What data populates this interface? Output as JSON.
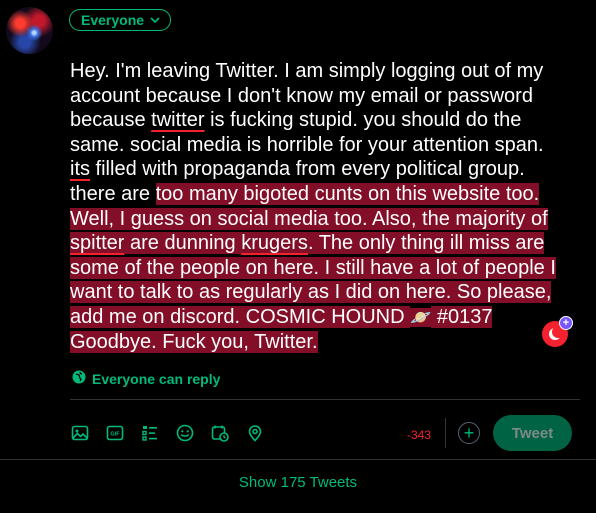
{
  "audience": {
    "label": "Everyone"
  },
  "tweet": {
    "lines": [
      [
        {
          "t": "Hey. I'm leaving Twitter. I am simply logging out of my"
        }
      ],
      [
        {
          "t": "account because I don't know my email or password"
        }
      ],
      [
        {
          "t": "because "
        },
        {
          "t": "twitter",
          "ul": true
        },
        {
          "t": " is fucking stupid. you should do the"
        }
      ],
      [
        {
          "t": "same. social media is horrible for your attention span."
        }
      ],
      [
        {
          "t": "its",
          "ul": true
        },
        {
          "t": " filled with propaganda from every political group."
        }
      ],
      [
        {
          "t": "there are "
        },
        {
          "t": "too many bigoted cunts on this website too.",
          "hl": true
        }
      ],
      [
        {
          "t": "Well, I guess on social media too. Also, the majority of",
          "hl": true
        }
      ],
      [
        {
          "t": "spitter",
          "hl": true,
          "ul": true
        },
        {
          "t": " are dunning ",
          "hl": true
        },
        {
          "t": "krugers",
          "hl": true,
          "ul": true
        },
        {
          "t": ". The only thing ill miss are",
          "hl": true
        }
      ],
      [
        {
          "t": "some of the people on here. I still have a lot of people I",
          "hl": true
        }
      ],
      [
        {
          "t": "want to talk to as regularly as I did on here. So please,",
          "hl": true
        }
      ],
      [
        {
          "t": "add me on discord. COSMIC HOUND  ",
          "hl": true
        },
        {
          "t": "🪐",
          "hl": true,
          "emoji": true
        },
        {
          "t": " #0137",
          "hl": true
        }
      ],
      [
        {
          "t": "Goodbye. Fuck you, Twitter.",
          "hl": true
        }
      ]
    ]
  },
  "reply_setting": {
    "label": "Everyone can reply"
  },
  "composer": {
    "char_count": "-343",
    "tweet_button": "Tweet",
    "add_button": "+"
  },
  "show_more": {
    "label": "Show 175 Tweets"
  },
  "toolbar_icons": [
    "image-icon",
    "gif-icon",
    "poll-icon",
    "emoji-icon",
    "schedule-icon",
    "location-icon"
  ],
  "colors": {
    "accent": "#00ba7c",
    "highlight": "#820e28",
    "error": "#f4212e",
    "tweet_button_bg": "#006344"
  }
}
